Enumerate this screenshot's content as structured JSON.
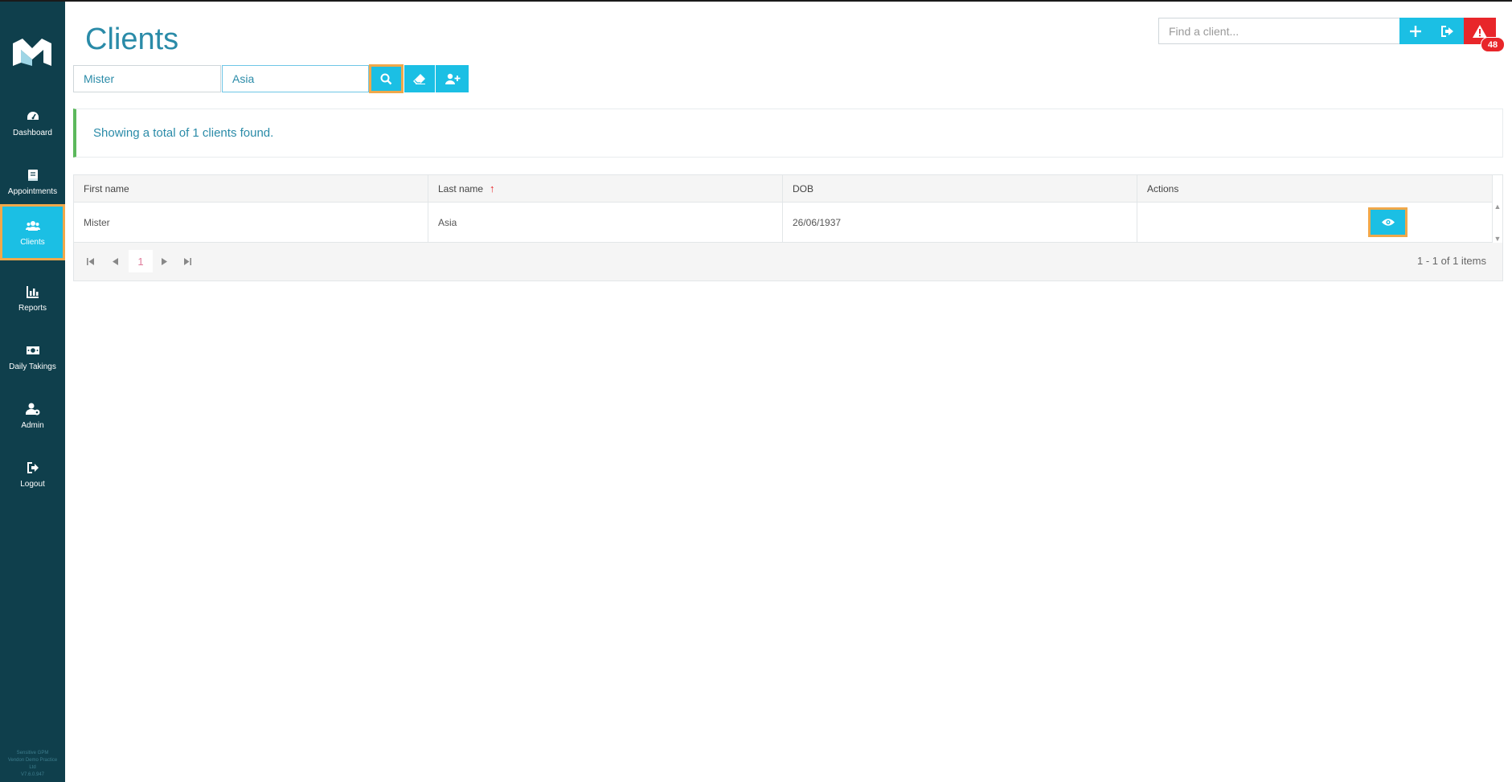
{
  "sidebar": {
    "items": [
      {
        "label": "Dashboard",
        "icon": "gauge-icon"
      },
      {
        "label": "Appointments",
        "icon": "book-icon"
      },
      {
        "label": "Clients",
        "icon": "users-icon",
        "active": true
      },
      {
        "label": "Reports",
        "icon": "bar-chart-icon"
      },
      {
        "label": "Daily Takings",
        "icon": "money-icon"
      },
      {
        "label": "Admin",
        "icon": "user-cog-icon"
      },
      {
        "label": "Logout",
        "icon": "sign-out-icon"
      }
    ],
    "footer": [
      "Sensitive GPM",
      "Vendon Demo Practice",
      "Ltd",
      "V7.6.0.947"
    ]
  },
  "page": {
    "title": "Clients"
  },
  "filters": {
    "first_name": "Mister",
    "last_name": "Asia"
  },
  "topbar": {
    "find_placeholder": "Find a client...",
    "alert_count": "48"
  },
  "results": {
    "message": "Showing a total of 1 clients found."
  },
  "grid": {
    "columns": [
      "First name",
      "Last name",
      "DOB",
      "Actions"
    ],
    "sort_indicator": "↑",
    "rows": [
      {
        "first_name": "Mister",
        "last_name": "Asia",
        "dob": "26/06/1937"
      }
    ],
    "pager": {
      "current_page": "1",
      "info": "1 - 1 of 1 items"
    }
  },
  "colors": {
    "sidebar": "#0f3f4c",
    "accent": "#1bbfe4",
    "highlight": "#f0a84a",
    "alert": "#e8262a",
    "success": "#5cb85c"
  }
}
